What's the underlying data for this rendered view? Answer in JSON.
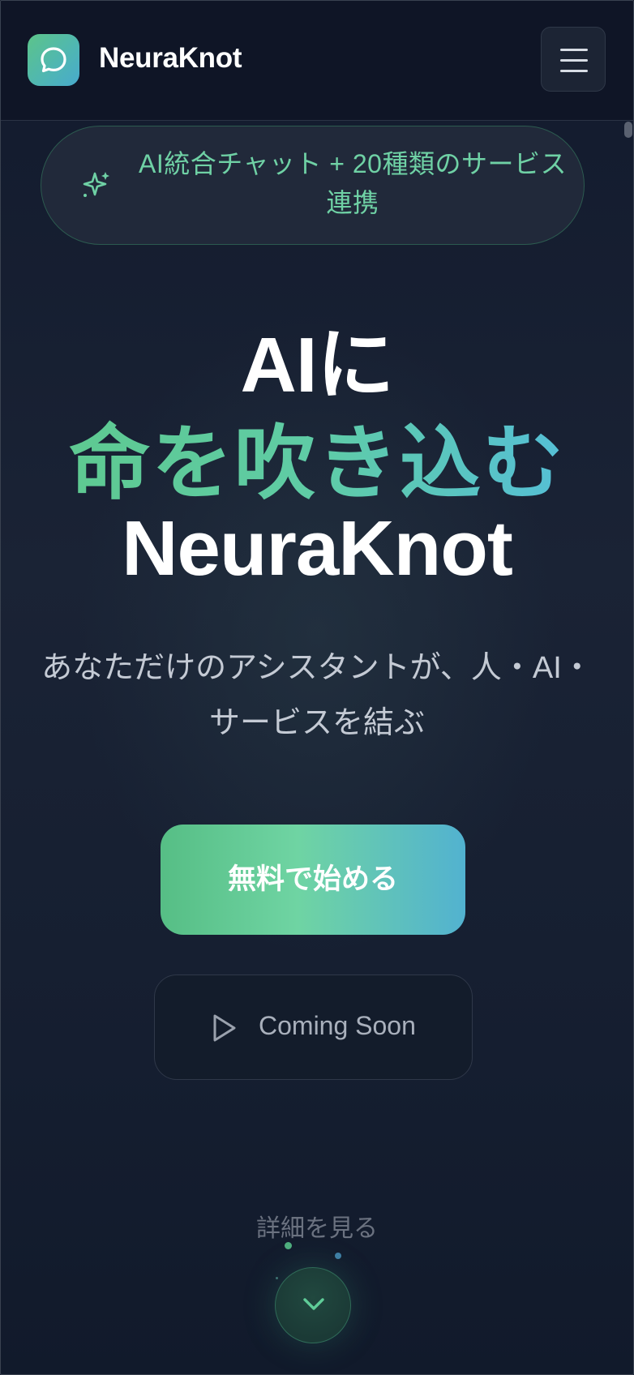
{
  "header": {
    "brand": "NeuraKnot",
    "logo_icon": "chat-bubble-icon",
    "menu_icon": "hamburger-menu-icon"
  },
  "badge": {
    "icon": "sparkles-icon",
    "text": "AI統合チャット + 20種類のサービス連携"
  },
  "hero": {
    "line1": "AIに",
    "line2": "命を吹き込む",
    "line3": "NeuraKnot",
    "subtitle": "あなただけのアシスタントが、人・AI・サービスを結ぶ"
  },
  "actions": {
    "primary_label": "無料で始める",
    "secondary_label": "Coming Soon",
    "secondary_icon": "play-icon"
  },
  "scroll_hint": {
    "label": "詳細を見る",
    "icon": "chevron-down-icon"
  },
  "colors": {
    "background": "#0f1628",
    "accent_green": "#5ec991",
    "accent_teal": "#55bfd6",
    "badge_text": "#6fd1a5"
  }
}
